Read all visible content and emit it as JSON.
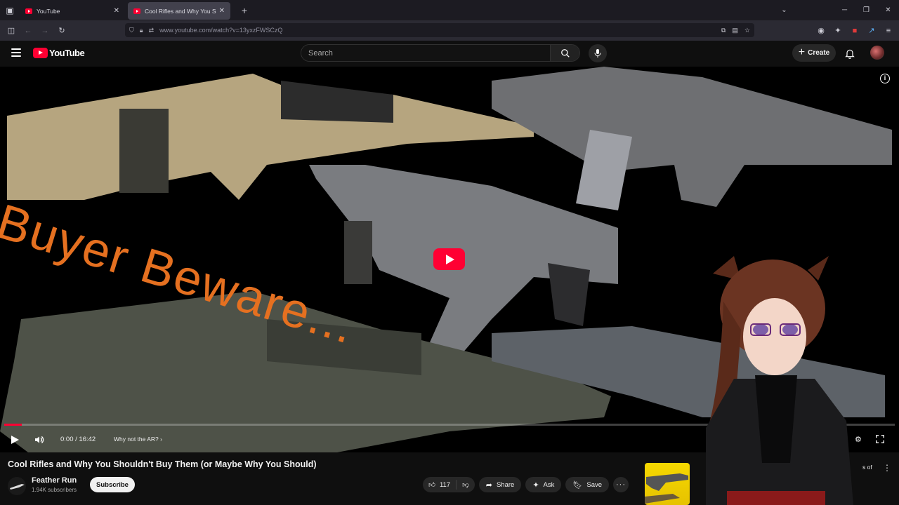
{
  "browser": {
    "tabs": [
      {
        "title": "YouTube",
        "active": false
      },
      {
        "title": "Cool Rifles and Why You Shoulc",
        "active": true
      }
    ],
    "url": "www.youtube.com/watch?v=13yxzFWSCzQ"
  },
  "header": {
    "logo_text": "YouTube",
    "search_placeholder": "Search",
    "create_label": "Create"
  },
  "video": {
    "overlay_text_main": "Buyer Beware...",
    "time": "0:00 / 16:42",
    "chapter": "Why not the AR?",
    "progress": 0.02
  },
  "details": {
    "title": "Cool Rifles and Why You Shouldn't Buy Them (or Maybe Why You Should)",
    "channel_name": "Feather Run",
    "subscribers": "1.94K subscribers",
    "subscribe_label": "Subscribe",
    "likes": "117",
    "share_label": "Share",
    "ask_label": "Ask",
    "save_label": "Save",
    "side_text": "s of"
  },
  "colors": {
    "brand": "#ff0033",
    "overlay_text": "#e57020"
  }
}
